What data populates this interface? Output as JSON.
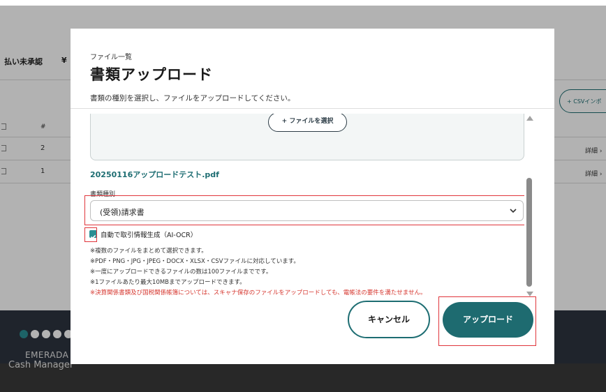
{
  "background": {
    "summary_label": "払い未承認",
    "summary_currency": "¥",
    "table_header_hash": "#",
    "rows": [
      {
        "num": "2",
        "detail": "詳細 ›"
      },
      {
        "num": "1",
        "detail": "詳細 ›"
      }
    ],
    "csv_button": "+ CSVインポ",
    "brand_name": "EMERADA",
    "brand_sub": "Cash Manager"
  },
  "modal": {
    "breadcrumb": "ファイル一覧",
    "title": "書類アップロード",
    "description": "書類の種別を選択し、ファイルをアップロードしてください。",
    "select_file_button": "+ ファイルを選択",
    "file_name": "20250116アップロードテスト.pdf",
    "doc_type_label": "書類種別",
    "doc_type_value": "(受領)請求書",
    "auto_ocr_label": "自動で取引情報生成（AI-OCR）",
    "auto_ocr_checked": true,
    "notes": [
      "※複数のファイルをまとめて選択できます。",
      "※PDF・PNG・JPG・JPEG・DOCX・XLSX・CSVファイルに対応しています。",
      "※一度にアップロードできるファイルの数は100ファイルまでです。",
      "※1ファイルあたり最大10MBまでアップロードできます。"
    ],
    "warning": "※決算関係書類及び国税関係帳簿については、スキャナ保存のファイルをアップロードしても、電帳法の要件を満たせません。",
    "cancel_button": "キャンセル",
    "upload_button": "アップロード"
  },
  "colors": {
    "accent": "#1e6b70",
    "highlight": "#e0353b",
    "warning": "#d6372f"
  },
  "icons": [
    "chevron-down-icon",
    "checkbox-checked-icon",
    "scroll-up-icon",
    "scroll-down-icon"
  ]
}
